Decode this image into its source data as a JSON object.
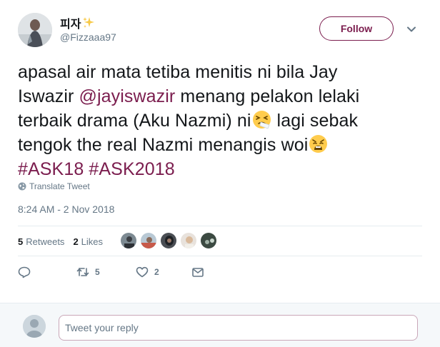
{
  "user": {
    "display_name": "피자",
    "handle": "@Fizzaaa97"
  },
  "follow_label": "Follow",
  "tweet": {
    "line1": "apasal air mata tetiba menitis ni bila Jay",
    "line2_text": "Iswazir ",
    "line2_mention": "@jayiswazir",
    "line2_rest": " menang pelakon lelaki",
    "line3": "terbaik drama (Aku Nazmi) ni",
    "line4_a": " lagi sebak",
    "line4_b": "tengok the real Nazmi menangis woi",
    "hashtag1": "#ASK18",
    "hashtag2": "#ASK2018",
    "emoji1": "sneezing-face",
    "emoji2": "weary-face"
  },
  "translate_label": "Translate Tweet",
  "timestamp": "8:24 AM - 2 Nov 2018",
  "stats": {
    "retweets_count": "5",
    "retweets_label": "Retweets",
    "likes_count": "2",
    "likes_label": "Likes"
  },
  "actions": {
    "reply_icon": "reply-icon",
    "retweet_icon": "retweet-icon",
    "retweet_count": "5",
    "like_icon": "heart-icon",
    "like_count": "2",
    "dm_icon": "envelope-icon"
  },
  "reply": {
    "placeholder": "Tweet your reply"
  },
  "colors": {
    "accent": "#7b1d4e",
    "muted": "#657786",
    "text": "#14171a",
    "border": "#e6ecf0"
  }
}
